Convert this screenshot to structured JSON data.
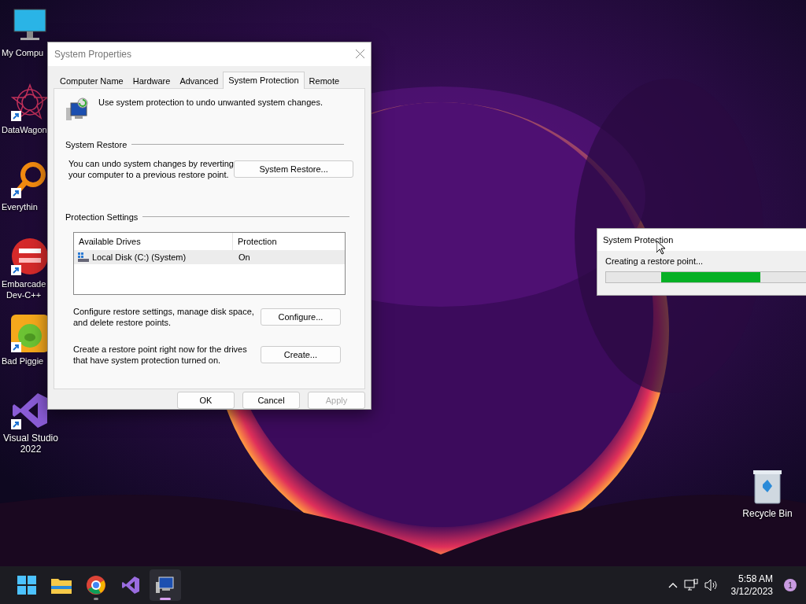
{
  "desktop_icons": [
    {
      "label": "My Compu",
      "kind": "monitor",
      "shortcut": false
    },
    {
      "label": "DataWagon",
      "kind": "star",
      "shortcut": true
    },
    {
      "label": "Everythin",
      "kind": "magnifier",
      "shortcut": true
    },
    {
      "label": "Embarcade\nDev-C++",
      "kind": "devcpp",
      "shortcut": true
    },
    {
      "label": "Bad Piggie",
      "kind": "pig",
      "shortcut": true
    },
    {
      "label": "Visual Studio\n2022",
      "kind": "vs",
      "shortcut": true
    }
  ],
  "recycle_bin": {
    "label": "Recycle Bin"
  },
  "system_properties": {
    "title": "System Properties",
    "tabs": [
      {
        "label": "Computer Name",
        "selected": false
      },
      {
        "label": "Hardware",
        "selected": false
      },
      {
        "label": "Advanced",
        "selected": false
      },
      {
        "label": "System Protection",
        "selected": true
      },
      {
        "label": "Remote",
        "selected": false
      }
    ],
    "intro": "Use system protection to undo unwanted system changes.",
    "system_restore": {
      "heading": "System Restore",
      "description": "You can undo system changes by reverting your computer to a previous restore point.",
      "button": "System Restore..."
    },
    "protection_settings": {
      "heading": "Protection Settings",
      "columns": [
        "Available Drives",
        "Protection"
      ],
      "rows": [
        {
          "drive": "Local Disk (C:) (System)",
          "protection": "On",
          "selected": true
        }
      ],
      "actions": [
        {
          "description": "Configure restore settings, manage disk space, and delete restore points.",
          "button": "Configure..."
        },
        {
          "description": "Create a restore point right now for the drives that have system protection turned on.",
          "button": "Create..."
        }
      ]
    },
    "buttons": [
      {
        "label": "OK",
        "disabled": false
      },
      {
        "label": "Cancel",
        "disabled": false
      },
      {
        "label": "Apply",
        "disabled": true
      }
    ]
  },
  "progress_window": {
    "title": "System Protection",
    "status": "Creating a restore point...",
    "marquee": true
  },
  "taskbar": {
    "apps": [
      {
        "kind": "start",
        "running": false,
        "active": false
      },
      {
        "kind": "folder",
        "running": false,
        "active": false
      },
      {
        "kind": "chrome",
        "running": true,
        "active": false
      },
      {
        "kind": "vs",
        "running": false,
        "active": false
      },
      {
        "kind": "sysprop",
        "running": true,
        "active": true
      }
    ],
    "time": "5:58 AM",
    "date": "3/12/2023",
    "notifications": "1"
  }
}
